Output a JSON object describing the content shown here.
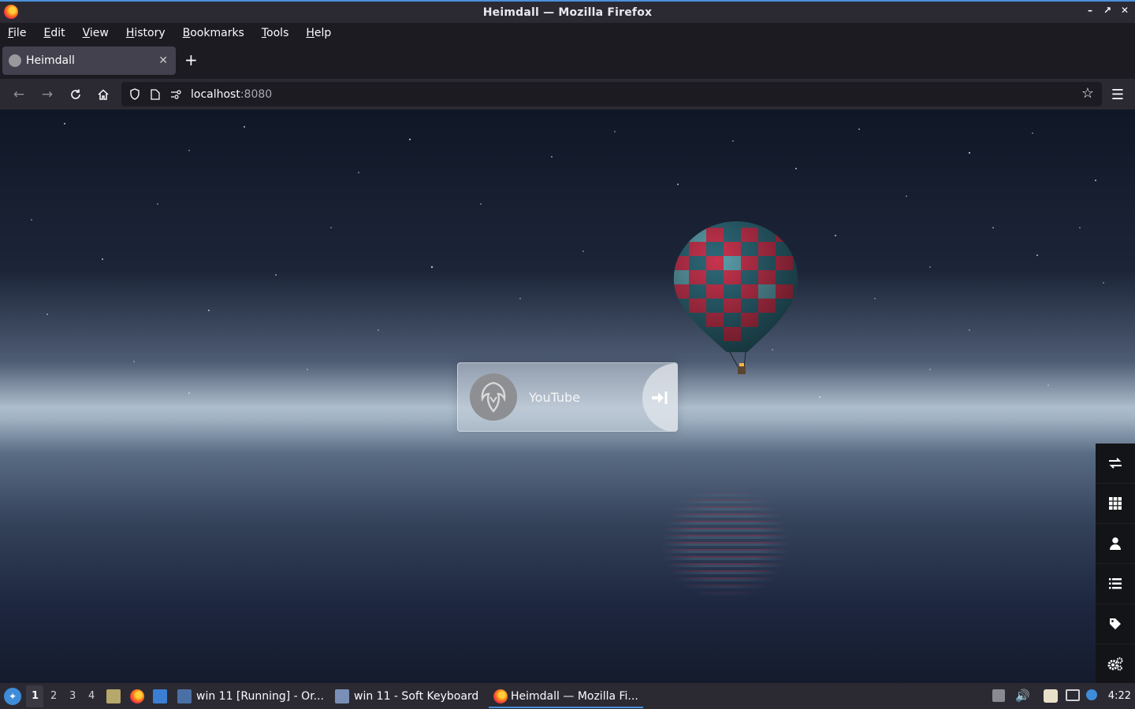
{
  "window": {
    "title": "Heimdall — Mozilla Firefox"
  },
  "menu": {
    "items": [
      "File",
      "Edit",
      "View",
      "History",
      "Bookmarks",
      "Tools",
      "Help"
    ]
  },
  "tab": {
    "title": "Heimdall"
  },
  "urlbar": {
    "host": "localhost",
    "port": ":8080"
  },
  "app_card": {
    "title": "YouTube",
    "icon": "heimdall-logo-icon",
    "go_icon": "arrow-right-to-bracket-icon"
  },
  "sidebar": {
    "icons": [
      "exchange-icon",
      "grid-icon",
      "user-icon",
      "list-icon",
      "tag-icon",
      "cogs-icon"
    ]
  },
  "taskbar": {
    "workspaces": [
      "1",
      "2",
      "3",
      "4"
    ],
    "active_workspace": "1",
    "tasks": [
      "win 11 [Running] - Or...",
      "win 11 - Soft Keyboard",
      "Heimdall — Mozilla Fi..."
    ],
    "clock": "4:22"
  },
  "colors": {
    "accent": "#4a90d9",
    "chrome_bg": "#2b2a33",
    "tab_bg": "#42414d",
    "sidebar_bg": "#131417"
  }
}
